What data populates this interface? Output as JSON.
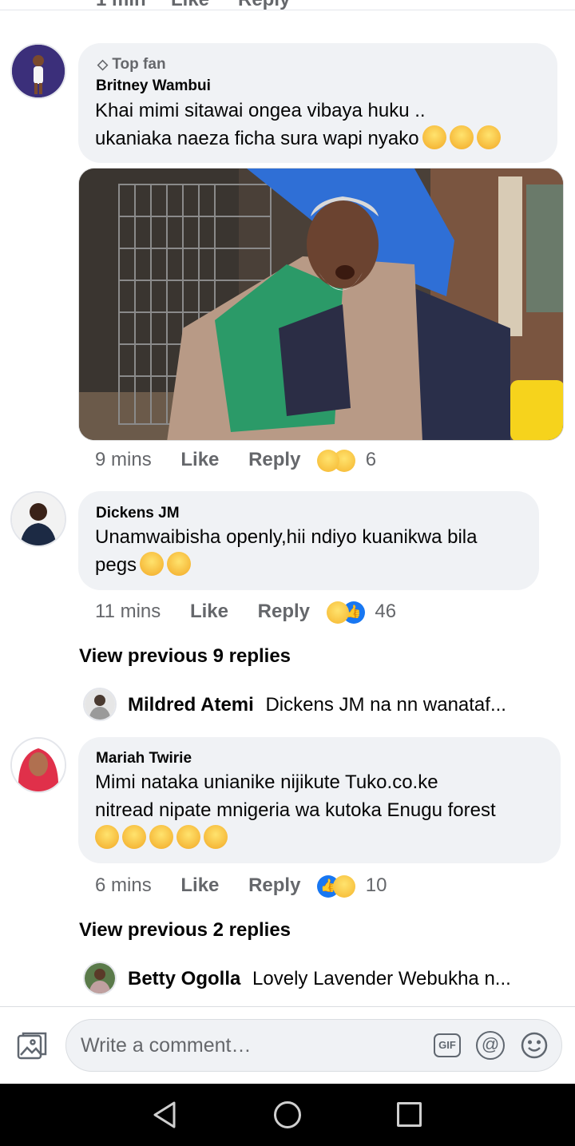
{
  "top_cut": {
    "time": "1 min",
    "like": "Like",
    "reply": "Reply"
  },
  "comments": [
    {
      "badge": "Top fan",
      "author": "Britney Wambui",
      "text_line1": "Khai mimi sitawai ongea vibaya huku ..",
      "text_line2": "ukaniaka naeza ficha sura wapi nyako",
      "time": "9 mins",
      "like": "Like",
      "reply": "Reply",
      "reaction_count": "6"
    },
    {
      "author": "Dickens JM",
      "text_line1": "Unamwaibisha openly,hii ndiyo kuanikwa bila",
      "text_line2": "pegs",
      "time": "11 mins",
      "like": "Like",
      "reply": "Reply",
      "reaction_count": "46",
      "view_previous": "View previous 9 replies",
      "last_reply": {
        "author": "Mildred Atemi",
        "snippet": "Dickens JM na nn wanataf..."
      }
    },
    {
      "author": "Mariah Twirie",
      "text_line1": "Mimi nataka unianike nijikute Tuko.co.ke",
      "text_line2": "nitread nipate mnigeria wa kutoka Enugu forest",
      "time": "6 mins",
      "like": "Like",
      "reply": "Reply",
      "reaction_count": "10",
      "view_previous": "View previous 2 replies",
      "last_reply": {
        "author": "Betty Ogolla",
        "snippet": "Lovely Lavender Webukha n..."
      }
    }
  ],
  "composer": {
    "placeholder": "Write a comment…",
    "gif_label": "GIF"
  },
  "colors": {
    "bubble": "#f0f2f5",
    "meta": "#65676b",
    "like_blue": "#1877f2"
  }
}
